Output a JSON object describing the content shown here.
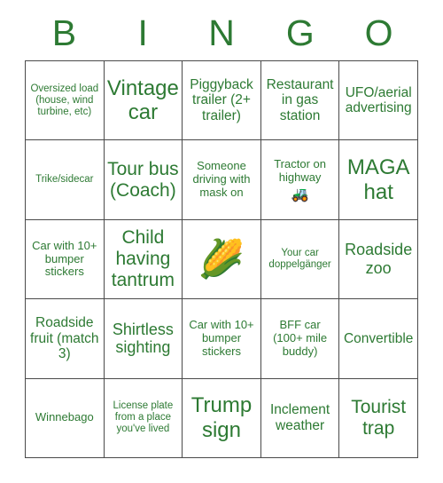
{
  "header": {
    "letters": [
      "B",
      "I",
      "N",
      "G",
      "O"
    ]
  },
  "colors": {
    "text_green": "#2d7a33",
    "grid_line": "#4a4a4a",
    "background": "#ffffff"
  },
  "grid": {
    "rows": 5,
    "columns": 5,
    "cells": [
      {
        "text": "Oversized load (house, wind turbine, etc)",
        "size": "xs",
        "emoji": ""
      },
      {
        "text": "Vintage car",
        "size": "xxl",
        "emoji": ""
      },
      {
        "text": "Piggyback trailer (2+ trailer)",
        "size": "m",
        "emoji": ""
      },
      {
        "text": "Restaurant in gas station",
        "size": "m",
        "emoji": ""
      },
      {
        "text": "UFO/aerial advertising",
        "size": "m",
        "emoji": ""
      },
      {
        "text": "Trike/sidecar",
        "size": "xs",
        "emoji": ""
      },
      {
        "text": "Tour bus (Coach)",
        "size": "xl",
        "emoji": ""
      },
      {
        "text": "Someone driving with mask on",
        "size": "s",
        "emoji": ""
      },
      {
        "text": "Tractor on highway",
        "size": "s",
        "emoji": "🚜",
        "emoji_name": "tractor-emoji",
        "emoji_size": "sm"
      },
      {
        "text": "MAGA hat",
        "size": "xxl",
        "emoji": ""
      },
      {
        "text": "Car with 10+ bumper stickers",
        "size": "s",
        "emoji": ""
      },
      {
        "text": "Child having tantrum",
        "size": "xl",
        "emoji": ""
      },
      {
        "text": "",
        "size": "m",
        "emoji": "🌽",
        "emoji_name": "corn-free-space-emoji",
        "emoji_size": "lg"
      },
      {
        "text": "Your car doppelgänger",
        "size": "xs",
        "emoji": ""
      },
      {
        "text": "Roadside zoo",
        "size": "l",
        "emoji": ""
      },
      {
        "text": "Roadside fruit (match 3)",
        "size": "m",
        "emoji": ""
      },
      {
        "text": "Shirtless sighting",
        "size": "l",
        "emoji": ""
      },
      {
        "text": "Car with 10+ bumper stickers",
        "size": "s",
        "emoji": ""
      },
      {
        "text": "BFF car (100+ mile buddy)",
        "size": "s",
        "emoji": ""
      },
      {
        "text": "Convertible",
        "size": "m",
        "emoji": ""
      },
      {
        "text": "Winnebago",
        "size": "s",
        "emoji": ""
      },
      {
        "text": "License plate from a place you've lived",
        "size": "xs",
        "emoji": ""
      },
      {
        "text": "Trump sign",
        "size": "xxl",
        "emoji": ""
      },
      {
        "text": "Inclement weather",
        "size": "m",
        "emoji": ""
      },
      {
        "text": "Tourist trap",
        "size": "xl",
        "emoji": ""
      }
    ]
  }
}
